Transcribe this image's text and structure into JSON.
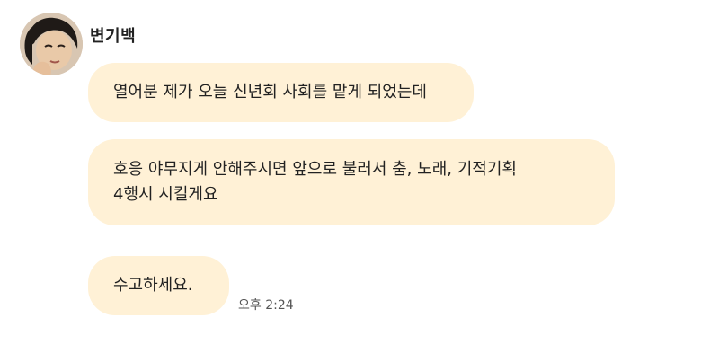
{
  "sender": {
    "name": "변기백",
    "avatar_icon": "profile-photo-avatar"
  },
  "messages": [
    {
      "lines": [
        "열어분 제가 오늘 신년회 사회를 맡게 되었는데"
      ]
    },
    {
      "lines": [
        "호응 야무지게 안해주시면 앞으로 불러서 춤, 노래, 기적기획",
        "4행시 시킬게요"
      ]
    },
    {
      "lines": [
        "수고하세요."
      ]
    }
  ],
  "timestamp": "오후 2:24",
  "colors": {
    "bubble": "#fff1d6",
    "text": "#222222",
    "timestamp": "#555555"
  }
}
